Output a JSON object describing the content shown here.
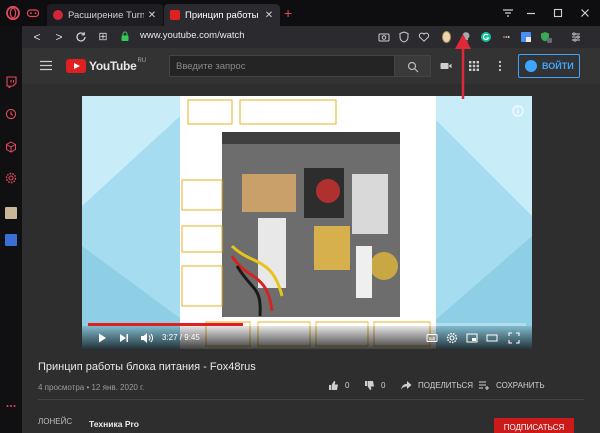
{
  "browser": {
    "tabs": [
      {
        "title": "Расширение Turn Off the Lights",
        "active": false
      },
      {
        "title": "Принцип работы блока питания",
        "active": true
      }
    ],
    "url": "www.youtube.com/watch",
    "accent": "#e14a5c"
  },
  "youtube": {
    "logo_text": "YouTube",
    "logo_region": "RU",
    "search_placeholder": "Введите запрос",
    "login_label": "ВОЙТИ"
  },
  "video": {
    "current_time": "3:27",
    "duration": "9:45",
    "progress_fraction": 0.355,
    "title": "Принцип работы блока питания - Fox48rus",
    "meta": "4 просмотра • 12 янв. 2020 г.",
    "likes": "0",
    "dislikes": "0",
    "share_label": "ПОДЕЛИТЬСЯ",
    "save_label": "СОХРАНИТЬ"
  },
  "channel": {
    "prefix": "ЛОНЕЙС",
    "name": "Техника Pro",
    "subscribe_label": "ПОДПИСАТЬСЯ"
  },
  "icons": {
    "tab_inactive": "opera-favicon",
    "tab_active": "youtube-favicon",
    "extension_highlight": "turn-off-the-lights-icon"
  }
}
